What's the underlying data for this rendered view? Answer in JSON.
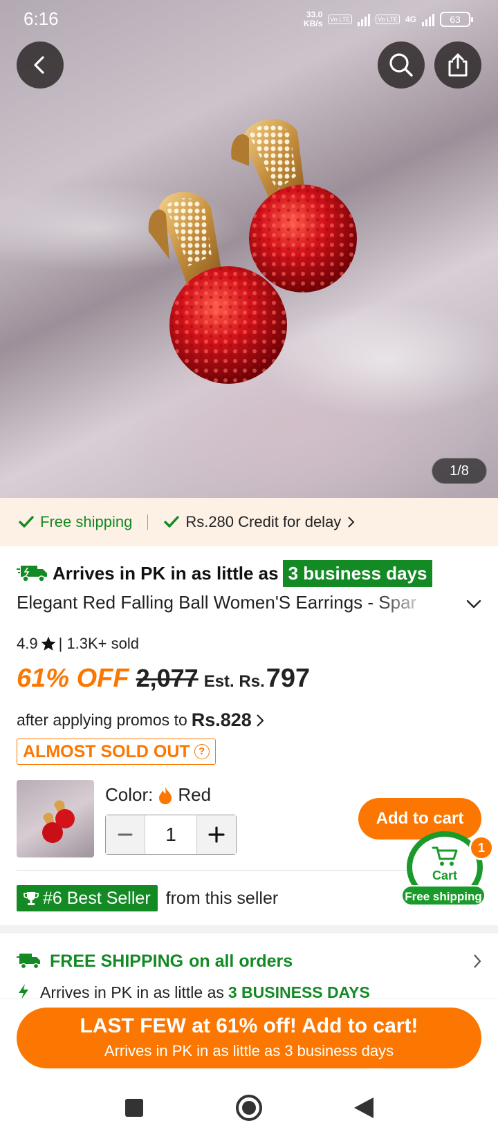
{
  "status_bar": {
    "time": "6:16",
    "net_speed_value": "33.0",
    "net_speed_unit": "KB/s",
    "lte1": "Vo LTE",
    "lte2": "Vo LTE",
    "net_type": "4G",
    "battery": "63"
  },
  "gallery": {
    "counter": "1/8"
  },
  "shipping_strip": {
    "free_shipping": "Free shipping",
    "credit": "Rs.280 Credit for delay"
  },
  "product": {
    "arrives_prefix": "Arrives in PK in as little as",
    "arrives_days": "3 business days",
    "title": "Elegant Red Falling Ball Women'S Earrings - Spar",
    "rating": "4.9",
    "sold": "| 1.3K+ sold",
    "discount": "61% OFF",
    "original_price": "2,077",
    "est_label": "Est. Rs.",
    "final_price": "797",
    "promo_prefix": "after applying promos to",
    "promo_price": "Rs.828",
    "sold_out": "ALMOST SOLD OUT",
    "color_label": "Color:",
    "color_value": "Red",
    "quantity": "1",
    "add_to_cart": "Add to cart"
  },
  "floating_cart": {
    "label": "Cart",
    "count": "1",
    "free_shipping": "Free shipping"
  },
  "best_seller": {
    "badge": "#6 Best Seller",
    "text": "from this seller"
  },
  "shipping_section": {
    "bold": "FREE SHIPPING",
    "rest": "on all orders",
    "partial_prefix": "Arrives in PK in as little as",
    "partial_days": "3 BUSINESS DAYS"
  },
  "cta": {
    "line1": "LAST FEW at 61% off! Add to cart!",
    "line2": "Arrives in PK in as little as 3 business days"
  },
  "colors": {
    "accent_orange": "#fb7701",
    "green": "#138a24"
  }
}
